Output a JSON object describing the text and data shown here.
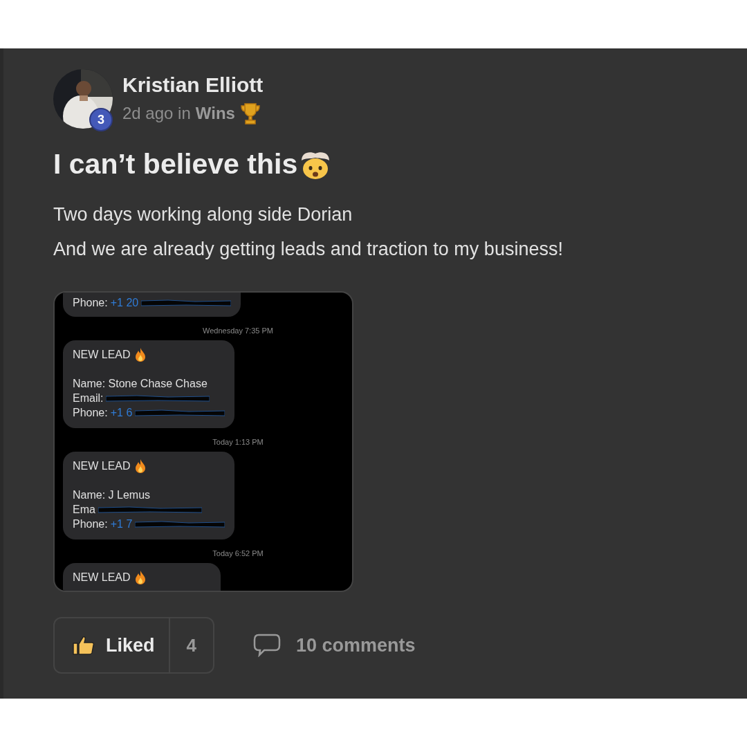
{
  "author": {
    "name": "Kristian Elliott",
    "level": "3",
    "time": "2d ago in",
    "category": "Wins"
  },
  "post": {
    "title": "I can’t believe this",
    "body": [
      "Two days working along side Dorian",
      "And we are already getting leads and traction to my business!"
    ]
  },
  "attachment": {
    "messages": [
      {
        "kind": "bubble",
        "lines": [
          {
            "kind": "redacted",
            "label": "Phone:",
            "link": "+1 20"
          }
        ]
      },
      {
        "kind": "timestamp",
        "text": "Wednesday 7:35 PM"
      },
      {
        "kind": "bubble",
        "heading": "NEW LEAD",
        "lines": [
          {
            "kind": "text",
            "label": "Name: Stone Chase Chase"
          },
          {
            "kind": "redacted",
            "label": "Email:"
          },
          {
            "kind": "redacted",
            "label": "Phone:",
            "link": "+1 6"
          }
        ]
      },
      {
        "kind": "timestamp",
        "text": "Today 1:13 PM"
      },
      {
        "kind": "bubble",
        "heading": "NEW LEAD",
        "lines": [
          {
            "kind": "text",
            "label": "Name: J Lemus"
          },
          {
            "kind": "redacted",
            "label": "Ema"
          },
          {
            "kind": "redacted",
            "label": "Phone:",
            "link": "+1 7"
          }
        ]
      },
      {
        "kind": "timestamp",
        "text": "Today 6:52 PM"
      },
      {
        "kind": "bubble",
        "heading": "NEW LEAD"
      }
    ]
  },
  "actions": {
    "like": {
      "label": "Liked",
      "liked": true,
      "count": "4"
    },
    "comments": "10 comments"
  }
}
